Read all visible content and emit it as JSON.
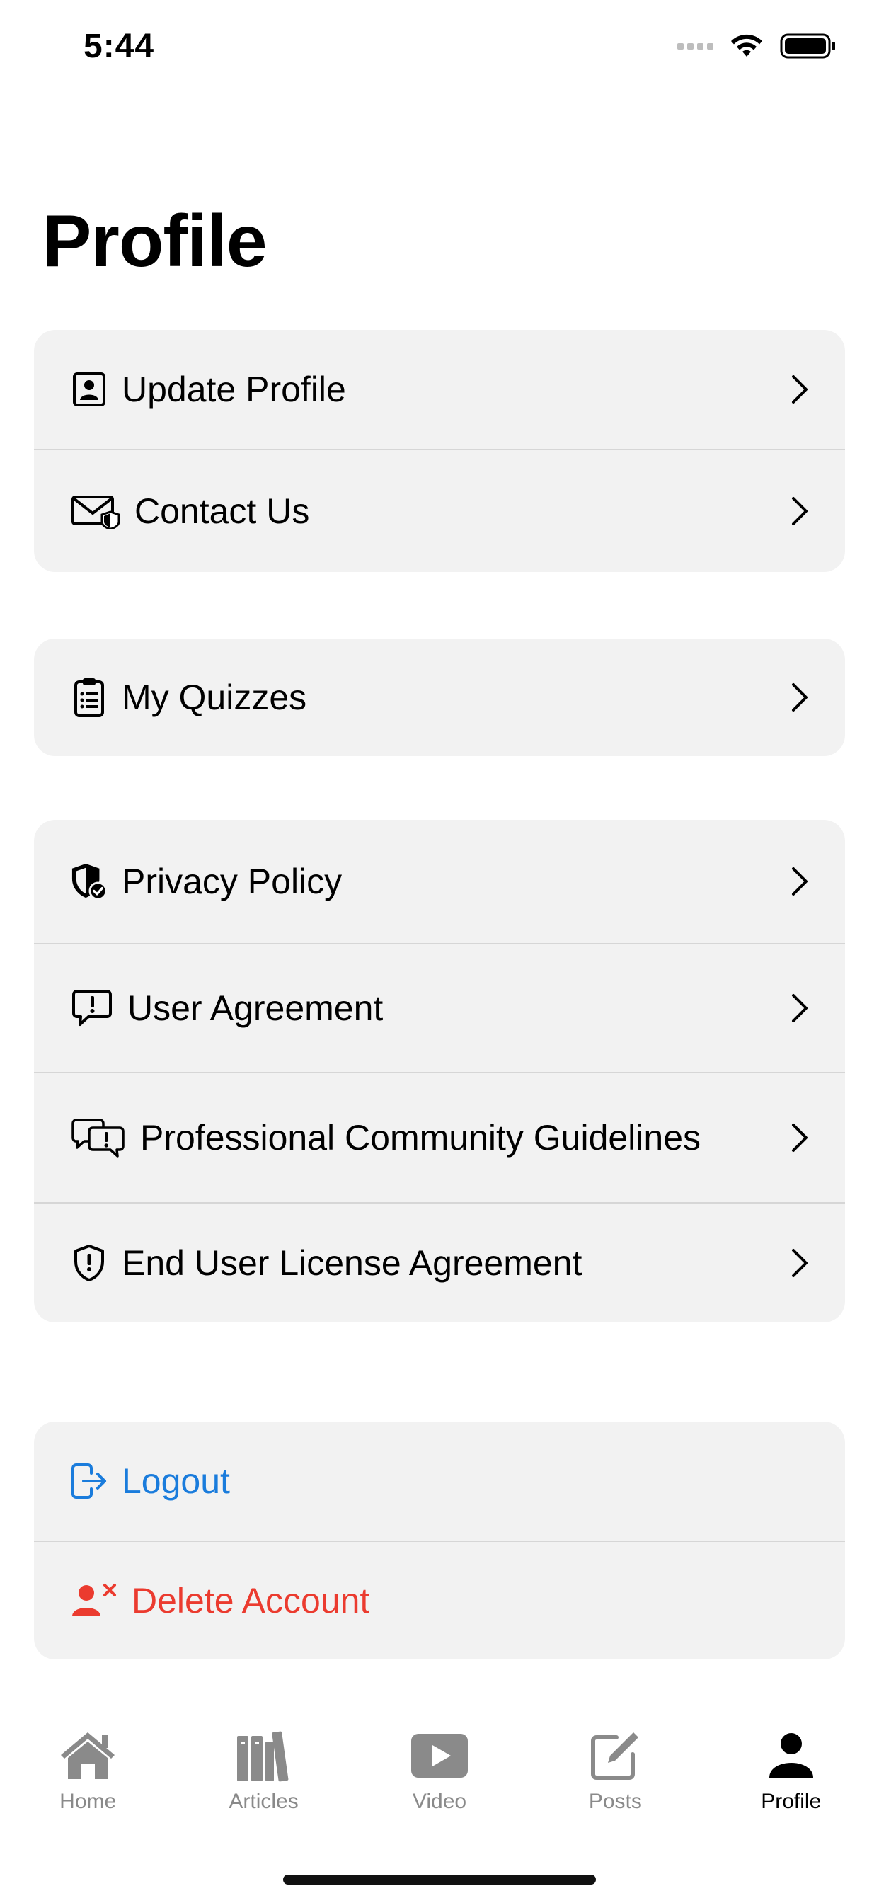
{
  "status_bar": {
    "time": "5:44"
  },
  "page": {
    "title": "Profile"
  },
  "groups": {
    "account": {
      "items": [
        {
          "label": "Update Profile",
          "icon": "person-badge-icon"
        },
        {
          "label": "Contact Us",
          "icon": "envelope-shield-icon"
        }
      ]
    },
    "quizzes": {
      "items": [
        {
          "label": "My Quizzes",
          "icon": "clipboard-list-icon"
        }
      ]
    },
    "legal": {
      "items": [
        {
          "label": "Privacy Policy",
          "icon": "shield-check-icon"
        },
        {
          "label": "User Agreement",
          "icon": "exclamation-bubble-icon"
        },
        {
          "label": "Professional Community Guidelines",
          "icon": "chat-bubbles-exclamation-icon"
        },
        {
          "label": "End User License Agreement",
          "icon": "exclamation-shield-icon"
        }
      ]
    },
    "session": {
      "logout_label": "Logout",
      "delete_label": "Delete Account"
    }
  },
  "tab_bar": {
    "tabs": [
      {
        "label": "Home",
        "icon": "house-icon",
        "active": false
      },
      {
        "label": "Articles",
        "icon": "books-icon",
        "active": false
      },
      {
        "label": "Video",
        "icon": "play-rectangle-icon",
        "active": false
      },
      {
        "label": "Posts",
        "icon": "square-pencil-icon",
        "active": false
      },
      {
        "label": "Profile",
        "icon": "person-icon",
        "active": true
      }
    ]
  },
  "colors": {
    "accent_blue": "#1a7cdc",
    "destructive_red": "#eb3b2f",
    "row_background": "#f2f2f2",
    "inactive_tab": "#8a8a8a"
  }
}
